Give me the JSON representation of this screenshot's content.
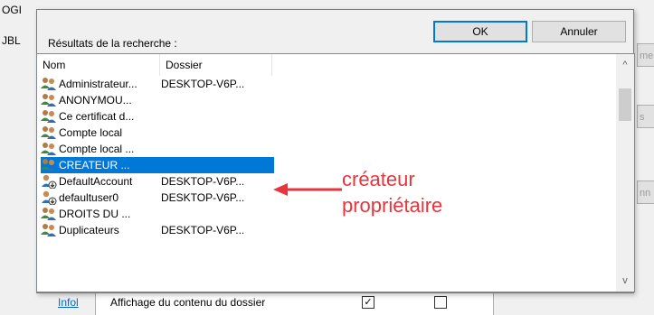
{
  "background": {
    "left_fragments": [
      "OGI",
      "JBL"
    ],
    "right_fragments": [
      "me",
      "s",
      "nn"
    ],
    "info_link": "Infol",
    "row_text": "Affichage du contenu du dossier",
    "check_mark": "✓"
  },
  "dialog": {
    "results_label": "Résultats de la recherche :",
    "ok_label": "OK",
    "cancel_label": "Annuler",
    "columns": [
      "Nom",
      "Dossier"
    ],
    "rows": [
      {
        "name": "Administrateur...",
        "folder": "DESKTOP-V6P...",
        "icon": "users-group-icon",
        "selected": false
      },
      {
        "name": "ANONYMOU...",
        "folder": "",
        "icon": "users-group-icon",
        "selected": false
      },
      {
        "name": "Ce certificat d...",
        "folder": "",
        "icon": "users-group-icon",
        "selected": false
      },
      {
        "name": "Compte local",
        "folder": "",
        "icon": "users-group-icon",
        "selected": false
      },
      {
        "name": "Compte local ...",
        "folder": "",
        "icon": "users-group-icon",
        "selected": false
      },
      {
        "name": "CREATEUR ...",
        "folder": "",
        "icon": "users-group-icon",
        "selected": true
      },
      {
        "name": "DefaultAccount",
        "folder": "DESKTOP-V6P...",
        "icon": "user-account-icon",
        "selected": false
      },
      {
        "name": "defaultuser0",
        "folder": "DESKTOP-V6P...",
        "icon": "user-account-icon",
        "selected": false
      },
      {
        "name": "DROITS DU ...",
        "folder": "",
        "icon": "users-group-icon",
        "selected": false
      },
      {
        "name": "Duplicateurs",
        "folder": "DESKTOP-V6P...",
        "icon": "users-group-icon",
        "selected": false
      }
    ],
    "scroll_up": "^",
    "scroll_down": "v"
  },
  "annotation": {
    "line1": "créateur",
    "line2": "propriétaire",
    "color": "#e8343c"
  },
  "colors": {
    "selection": "#0078d7",
    "link": "#0066cc"
  }
}
